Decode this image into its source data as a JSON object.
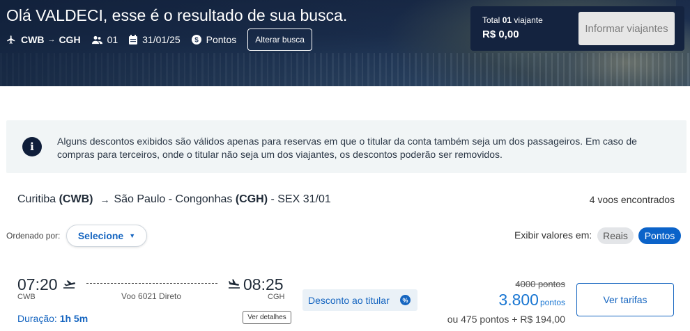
{
  "header": {
    "greeting": "Olá VALDECI, esse é o resultado de sua busca.",
    "origin_code": "CWB",
    "destination_code": "CGH",
    "passengers": "01",
    "date": "31/01/25",
    "payment_mode": "Pontos",
    "alter_button": "Alterar busca"
  },
  "total": {
    "label_prefix": "Total",
    "label_count": "01",
    "label_suffix": "viajante",
    "value": "R$ 0,00",
    "inform_button": "Informar viajantes"
  },
  "info_banner": {
    "text": "Alguns descontos exibidos são válidos apenas para reservas em que o titular da conta também seja um dos passageiros. Em caso de compras para terceiros, onde o titular não seja um dos viajantes, os descontos poderão ser removidos."
  },
  "route": {
    "origin_city": "Curitiba",
    "origin_code": "(CWB)",
    "destination_city": "São Paulo - Congonhas",
    "destination_code": "(CGH)",
    "date_label": "- SEX 31/01",
    "found_text": "4 voos encontrados"
  },
  "sort": {
    "label": "Ordenado por:",
    "selected": "Selecione"
  },
  "view_toggle": {
    "label": "Exibir valores em:",
    "options": [
      "Reais",
      "Pontos"
    ],
    "active": "Pontos"
  },
  "flights": [
    {
      "departure_time": "07:20",
      "departure_code": "CWB",
      "arrival_time": "08:25",
      "arrival_code": "CGH",
      "flight_info": "Voo 6021 Direto",
      "duration_label": "Duração:",
      "duration_value": "1h 5m",
      "details_button": "Ver detalhes",
      "discount_label": "Desconto ao titular",
      "old_price": "4000 pontos",
      "new_price": "3.800",
      "new_price_unit": "pontos",
      "alt_price": "ou 475 pontos + R$ 194,00",
      "fares_button": "Ver tarifas"
    }
  ],
  "colors": {
    "accent": "#1565c0",
    "dark_navy": "#14233f",
    "info_bg": "#f1f5f6"
  }
}
